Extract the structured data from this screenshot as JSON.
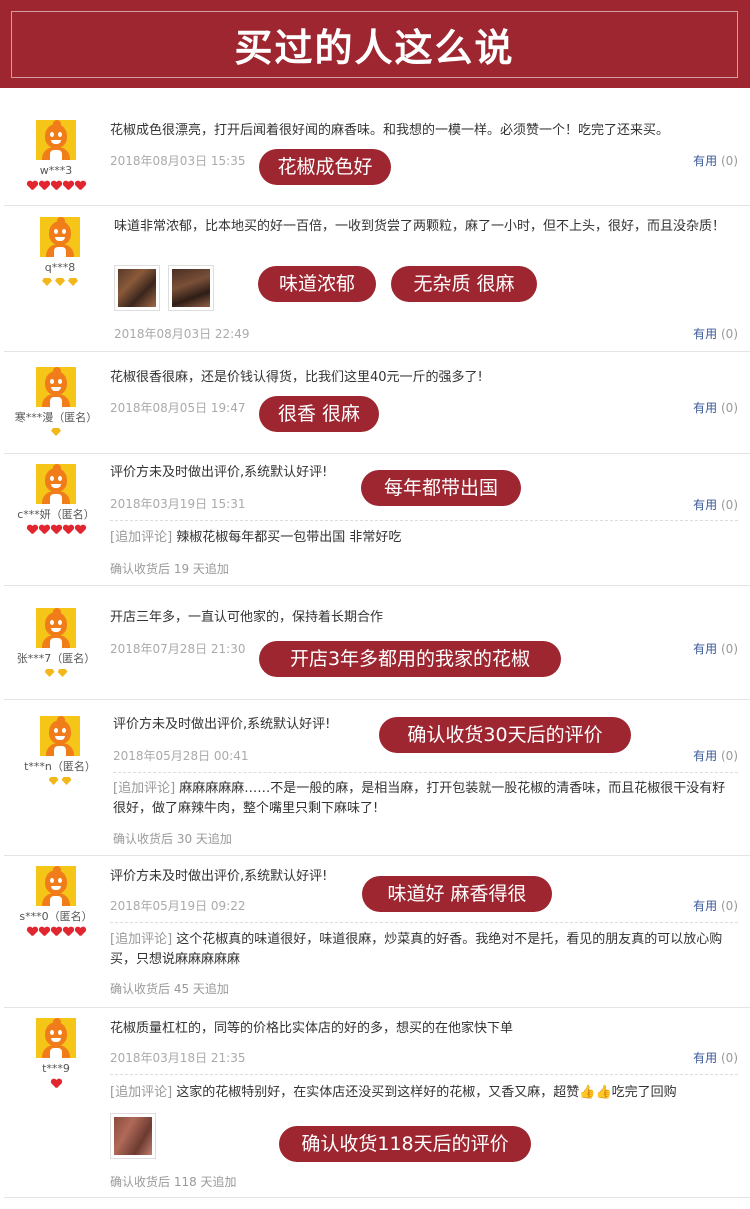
{
  "banner": {
    "title": "买过的人这么说"
  },
  "useful_label": "有用",
  "reviews": [
    {
      "user": "w***3",
      "rank": "hearts",
      "text": "花椒成色很漂亮，打开后闻着很好闻的麻香味。和我想的一模一样。必须赞一个！吃完了还来买。",
      "date": "2018年08月03日 15:35",
      "useful_count": "(0)",
      "tags": [
        "花椒成色好"
      ]
    },
    {
      "user": "q***8",
      "rank": "diamonds",
      "text": "味道非常浓郁，比本地买的好一百倍，一收到货尝了两颗粒，麻了一小时，但不上头，很好，而且没杂质！",
      "date": "2018年08月03日 22:49",
      "useful_count": "(0)",
      "tags": [
        "味道浓郁",
        "无杂质 很麻"
      ]
    },
    {
      "user": "寒***漫（匿名）",
      "rank": "diamond",
      "text": "花椒很香很麻，还是价钱认得货，比我们这里40元一斤的强多了!",
      "date": "2018年08月05日 19:47",
      "useful_count": "(0)",
      "tags": [
        "很香 很麻"
      ]
    },
    {
      "user": "c***妍（匿名）",
      "rank": "hearts",
      "text": "评价方未及时做出评价,系统默认好评!",
      "date": "2018年03月19日 15:31",
      "useful_count": "(0)",
      "append_tag": "[追加评论]",
      "append_text": "辣椒花椒每年都买一包带出国 非常好吃",
      "after": "确认收货后 19 天追加",
      "tags": [
        "每年都带出国"
      ]
    },
    {
      "user": "张***7（匿名）",
      "rank": "diamonds2",
      "text": "开店三年多，一直认可他家的，保持着长期合作",
      "date": "2018年07月28日 21:30",
      "useful_count": "(0)",
      "tags": [
        "开店3年多都用的我家的花椒"
      ]
    },
    {
      "user": "t***n（匿名）",
      "rank": "diamonds2",
      "text": "评价方未及时做出评价,系统默认好评!",
      "date": "2018年05月28日 00:41",
      "useful_count": "(0)",
      "append_tag": "[追加评论]",
      "append_text": "麻麻麻麻麻……不是一般的麻，是相当麻，打开包装就一股花椒的清香味，而且花椒很干没有籽很好，做了麻辣牛肉，整个嘴里只剩下麻味了!",
      "after": "确认收货后 30 天追加",
      "tags": [
        "确认收货30天后的评价"
      ]
    },
    {
      "user": "s***0（匿名）",
      "rank": "hearts",
      "text": "评价方未及时做出评价,系统默认好评!",
      "date": "2018年05月19日 09:22",
      "useful_count": "(0)",
      "append_tag": "[追加评论]",
      "append_text": "这个花椒真的味道很好，味道很麻，炒菜真的好香。我绝对不是托，看见的朋友真的可以放心购买，只想说麻麻麻麻麻",
      "after": "确认收货后 45 天追加",
      "tags": [
        "味道好 麻香得很"
      ]
    },
    {
      "user": "t***9",
      "rank": "heart",
      "text": "花椒质量杠杠的，同等的价格比实体店的好的多，想买的在他家快下单",
      "date": "2018年03月18日 21:35",
      "useful_count": "(0)",
      "append_tag": "[追加评论]",
      "append_text": "这家的花椒特别好，在实体店还没买到这样好的花椒，又香又麻，超赞👍👍吃完了回购",
      "after": "确认收货后 118 天追加",
      "tags": [
        "确认收货118天后的评价"
      ]
    }
  ]
}
